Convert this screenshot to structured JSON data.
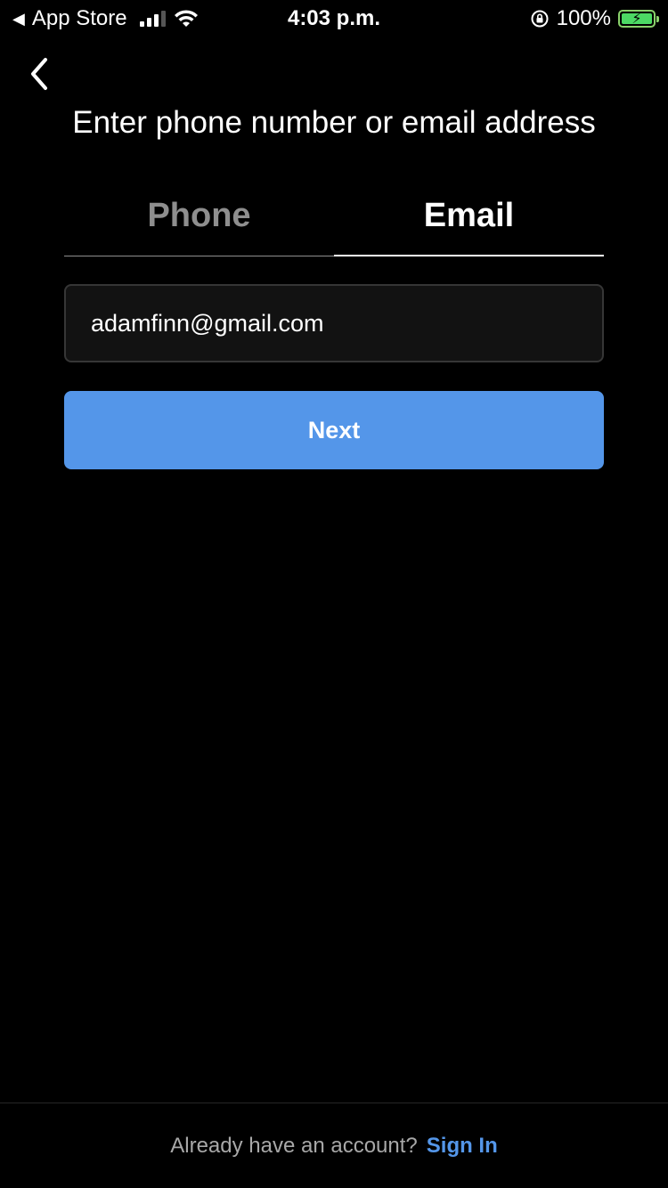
{
  "status_bar": {
    "back_app": "App Store",
    "time": "4:03 p.m.",
    "battery_percent": "100%",
    "battery_level": 1.0,
    "charging": true
  },
  "icons": {
    "back": "chevron-left-icon",
    "signal": "cellular-signal-icon",
    "wifi": "wifi-icon",
    "orientation_lock": "orientation-lock-icon",
    "battery": "battery-charging-icon"
  },
  "header": {
    "title": "Enter phone number or email address"
  },
  "tabs": [
    {
      "label": "Phone",
      "active": false
    },
    {
      "label": "Email",
      "active": true
    }
  ],
  "form": {
    "email_value": "adamfinn@gmail.com",
    "next_label": "Next"
  },
  "footer": {
    "prompt": "Already have an account?",
    "link": "Sign In"
  },
  "colors": {
    "background": "#000000",
    "accent": "#5496e9",
    "inactive_tab": "#8e8e8e",
    "input_background": "#121212",
    "battery": "#4cd964"
  }
}
